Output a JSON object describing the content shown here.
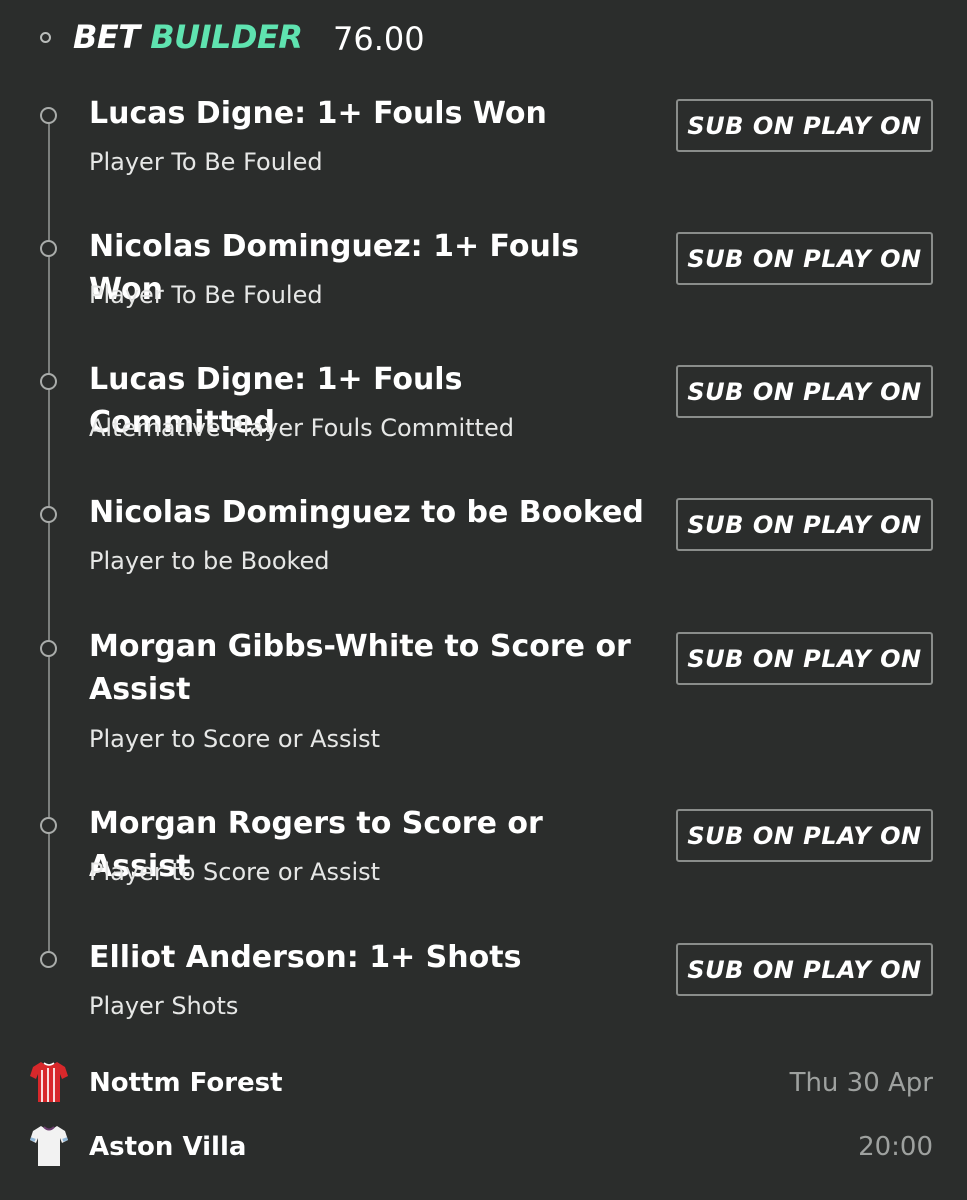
{
  "header": {
    "title_bet": "BET",
    "title_builder": "BUILDER",
    "odds": "76.00"
  },
  "legs": [
    {
      "title": "Lucas Digne: 1+ Fouls Won",
      "market": "Player To Be Fouled",
      "button": "SUB ON PLAY ON"
    },
    {
      "title": "Nicolas Dominguez: 1+ Fouls Won",
      "market": "Player To Be Fouled",
      "button": "SUB ON PLAY ON"
    },
    {
      "title": "Lucas Digne: 1+ Fouls Committed",
      "market": "Alternative Player Fouls Committed",
      "button": "SUB ON PLAY ON"
    },
    {
      "title": "Nicolas Dominguez to be Booked",
      "market": "Player to be Booked",
      "button": "SUB ON PLAY ON"
    },
    {
      "title": "Morgan Gibbs-White to Score or Assist",
      "market": "Player to Score or Assist",
      "button": "SUB ON PLAY ON"
    },
    {
      "title": "Morgan Rogers to Score or Assist",
      "market": "Player to Score or Assist",
      "button": "SUB ON PLAY ON"
    },
    {
      "title": "Elliot Anderson: 1+ Shots",
      "market": "Player Shots",
      "button": "SUB ON PLAY ON"
    }
  ],
  "match": {
    "home": {
      "name": "Nottm Forest",
      "kit_icon": "red-striped-shirt-icon"
    },
    "away": {
      "name": "Aston Villa",
      "kit_icon": "white-shirt-icon"
    },
    "date": "Thu 30 Apr",
    "time": "20:00"
  },
  "colors": {
    "background": "#2b2d2c",
    "accent_green": "#5fe3b0",
    "muted_text": "#9ea19f",
    "home_kit": "#d8282b",
    "away_kit": "#f2f2f2"
  }
}
